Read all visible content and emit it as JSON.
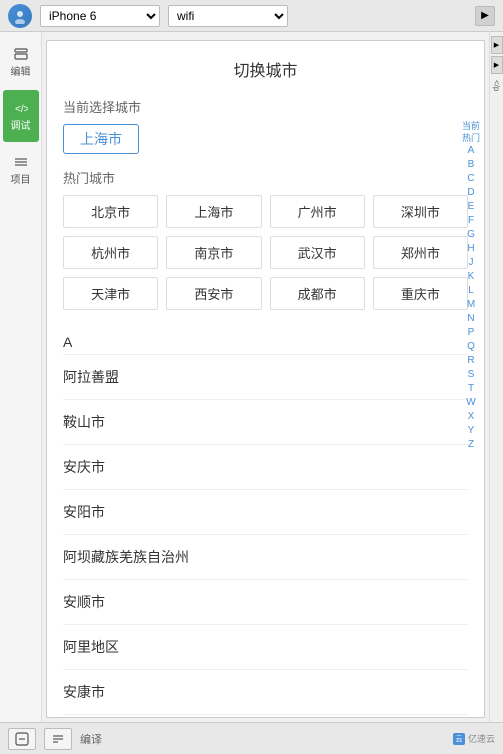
{
  "topbar": {
    "device_label": "iPhone 6",
    "wifi_label": "wifi",
    "expand_icon": "▼"
  },
  "sidebar": {
    "items": [
      {
        "id": "edit",
        "label": "编辑",
        "icon": "</>",
        "active": false
      },
      {
        "id": "debug",
        "label": "调试",
        "icon": "</>",
        "active": true
      },
      {
        "id": "project",
        "label": "项目",
        "icon": "≡",
        "active": false
      }
    ]
  },
  "page": {
    "title": "切换城市",
    "current_section_label": "当前选择城市",
    "current_city": "上海市",
    "hot_section_label": "热门城市",
    "hot_cities": [
      "北京市",
      "上海市",
      "广州市",
      "深圳市",
      "杭州市",
      "南京市",
      "武汉市",
      "郑州市",
      "天津市",
      "西安市",
      "成都市",
      "重庆市"
    ],
    "alpha_index_top": [
      "当前",
      "热门"
    ],
    "alpha_index": [
      "A",
      "B",
      "C",
      "D",
      "E",
      "F",
      "G",
      "H",
      "J",
      "K",
      "L",
      "M",
      "N",
      "P",
      "Q",
      "R",
      "S",
      "T",
      "W",
      "X",
      "Y",
      "Z"
    ],
    "city_groups": [
      {
        "letter": "A",
        "cities": [
          "阿拉善盟",
          "鞍山市",
          "安庆市",
          "安阳市",
          "阿坝藏族羌族自治州",
          "安顺市",
          "阿里地区",
          "安康市"
        ]
      }
    ]
  },
  "bottom": {
    "translate_label": "编译",
    "watermark": "亿速云"
  }
}
